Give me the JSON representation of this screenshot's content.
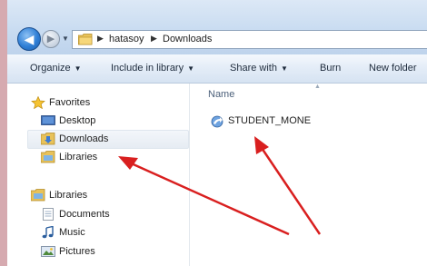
{
  "address_bar": {
    "breadcrumbs": [
      "hatasoy",
      "Downloads"
    ],
    "icons": {
      "back": "back-arrow-icon",
      "forward": "forward-arrow-icon",
      "folder": "folder-icon"
    }
  },
  "toolbar": {
    "items": [
      {
        "label": "Organize",
        "has_dropdown": true
      },
      {
        "label": "Include in library",
        "has_dropdown": true
      },
      {
        "label": "Share with",
        "has_dropdown": true
      },
      {
        "label": "Burn",
        "has_dropdown": false
      },
      {
        "label": "New folder",
        "has_dropdown": false
      }
    ]
  },
  "nav_pane": {
    "favorites_header": "Favorites",
    "favorites": [
      {
        "label": "Desktop",
        "icon": "desktop-icon"
      },
      {
        "label": "Downloads",
        "icon": "downloads-folder-icon",
        "selected": true
      },
      {
        "label": "Libraries",
        "icon": "libraries-icon"
      }
    ],
    "libraries_header": "Libraries",
    "libraries": [
      {
        "label": "Documents",
        "icon": "documents-icon"
      },
      {
        "label": "Music",
        "icon": "music-icon"
      },
      {
        "label": "Pictures",
        "icon": "pictures-icon"
      }
    ]
  },
  "content": {
    "column_header": "Name",
    "files": [
      {
        "name": "STUDENT_MONE",
        "icon": "shortcut-file-icon"
      }
    ]
  },
  "annotations": {
    "arrow_color": "#d91f1f"
  }
}
